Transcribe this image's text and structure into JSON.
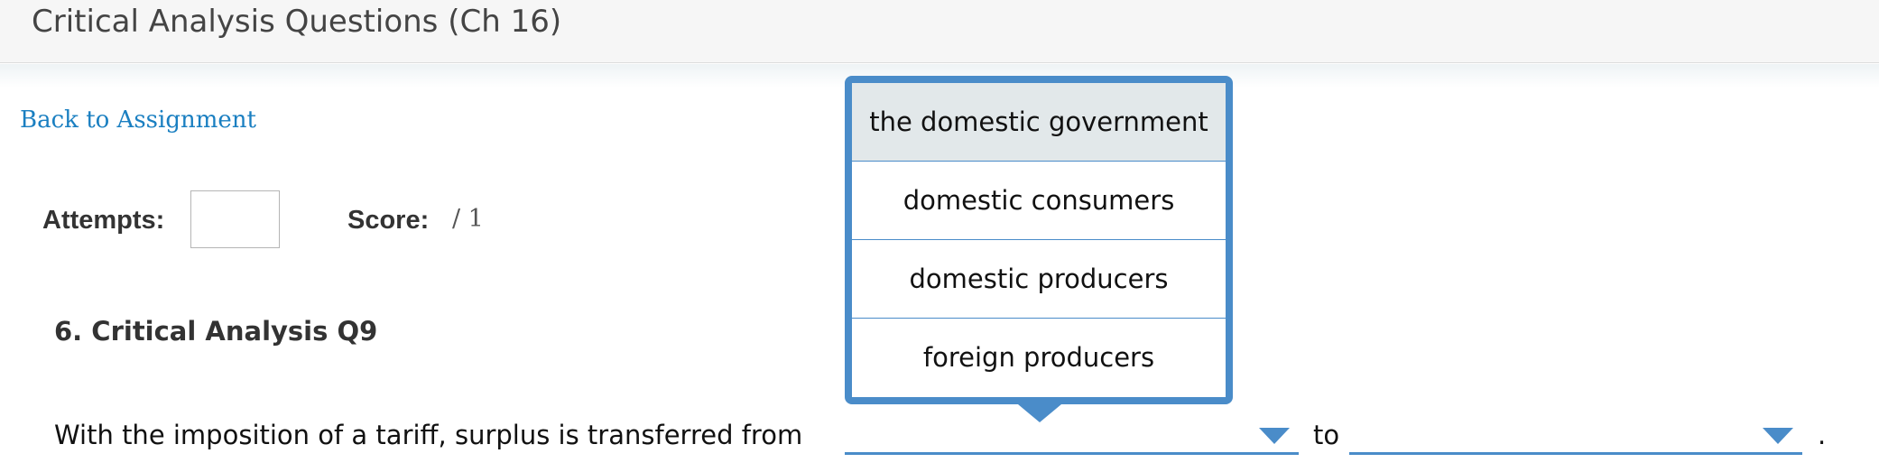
{
  "header": {
    "title": "Critical Analysis Questions (Ch 16)"
  },
  "nav": {
    "back_link": "Back to Assignment"
  },
  "stats": {
    "attempts_label": "Attempts:",
    "attempts_value": "",
    "score_label": "Score:",
    "score_value": "/ 1"
  },
  "question": {
    "title": "6. Critical Analysis Q9",
    "text": "With the imposition of a tariff, surplus is transferred from",
    "separator": "to",
    "end": "."
  },
  "blank_1": {
    "selected": ""
  },
  "blank_2": {
    "selected": ""
  },
  "dropdown": {
    "options": [
      "the domestic government",
      "domestic consumers",
      "domestic producers",
      "foreign producers"
    ],
    "highlighted_index": 0
  },
  "colors": {
    "accent": "#4a8cc9",
    "link": "#1a7fc1",
    "highlight": "#e2e8ea"
  },
  "icons": {
    "select_caret": "chevron-down-icon",
    "pointer": "dropdown-pointer-icon"
  }
}
